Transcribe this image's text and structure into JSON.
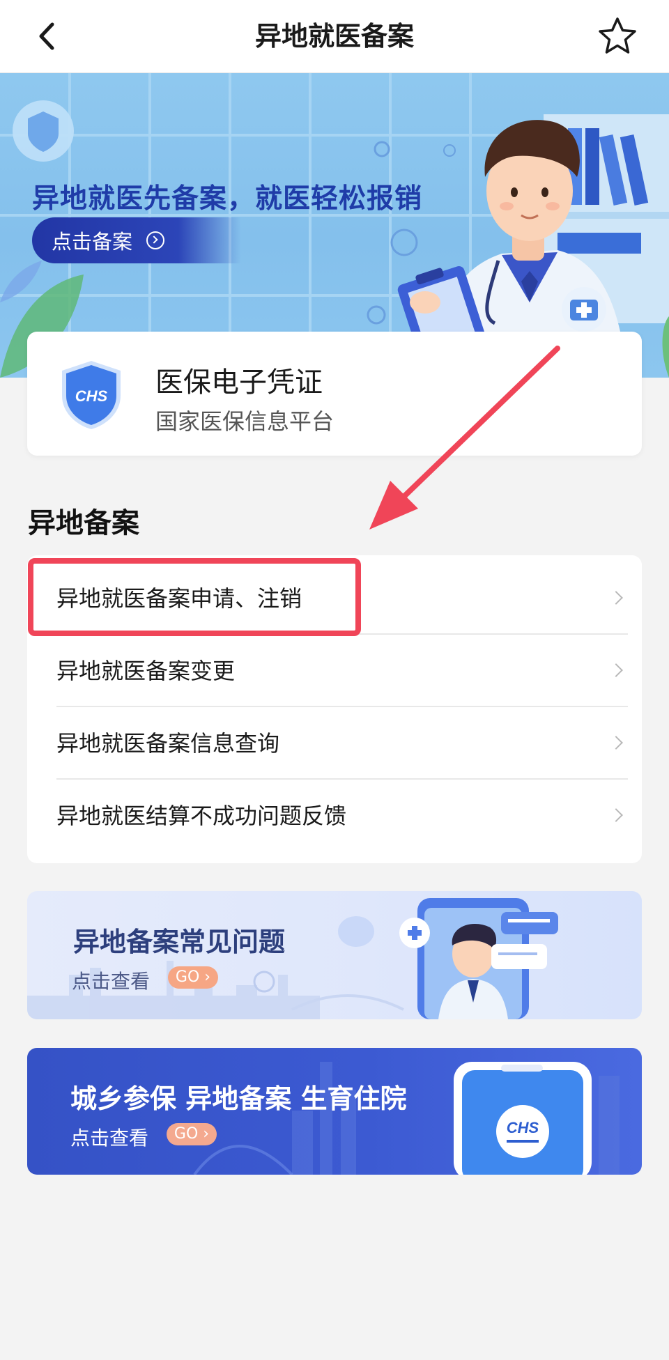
{
  "nav": {
    "title": "异地就医备案",
    "back_icon": "chevron-left-icon",
    "favorite_icon": "star-outline-icon"
  },
  "banner": {
    "headline": "异地就医先备案，就医轻松报销",
    "button_label": "点击备案"
  },
  "credential": {
    "title": "医保电子凭证",
    "subtitle": "国家医保信息平台",
    "logo_text": "CHS"
  },
  "section": {
    "title": "异地备案",
    "items": [
      {
        "label": "异地就医备案申请、注销",
        "highlighted": true
      },
      {
        "label": "异地就医备案变更",
        "highlighted": false
      },
      {
        "label": "异地就医备案信息查询",
        "highlighted": false
      },
      {
        "label": "异地就医结算不成功问题反馈",
        "highlighted": false
      }
    ]
  },
  "promos": [
    {
      "title": "异地备案常见问题",
      "subtitle": "点击查看",
      "go": "GO"
    },
    {
      "title": "城乡参保 异地备案 生育住院",
      "subtitle": "点击查看",
      "go": "GO"
    }
  ],
  "colors": {
    "highlight": "#f04558",
    "banner_text": "#1f3ca8",
    "promo2_bg": "#3552c6"
  }
}
